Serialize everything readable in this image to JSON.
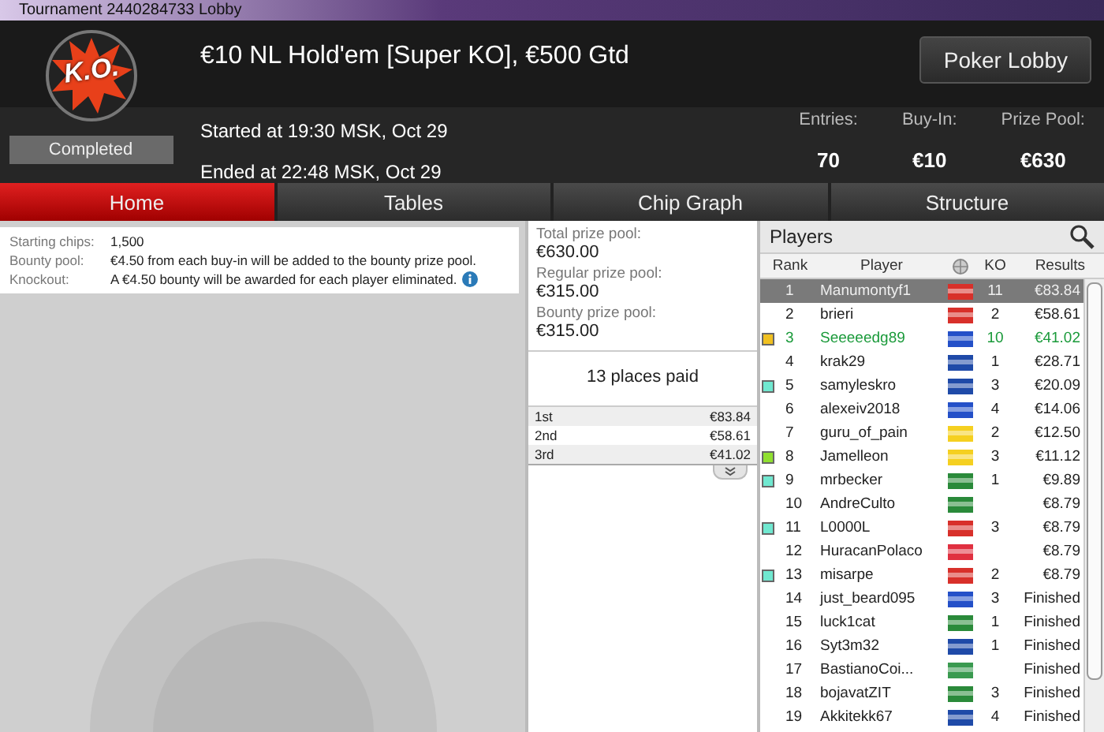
{
  "window": {
    "title": "Tournament 2440284733 Lobby"
  },
  "tournament": {
    "logo_text": "K.O.",
    "name": "€10 NL Hold'em [Super KO], €500 Gtd",
    "status": "Completed",
    "started": "Started at 19:30 MSK, Oct 29",
    "ended": "Ended at 22:48 MSK, Oct 29",
    "lobby_button": "Poker Lobby",
    "stats": [
      {
        "label": "Entries:",
        "value": "70"
      },
      {
        "label": "Buy-In:",
        "value": "€10"
      },
      {
        "label": "Prize Pool:",
        "value": "€630"
      }
    ]
  },
  "tabs": [
    {
      "label": "Home",
      "selected": true
    },
    {
      "label": "Tables",
      "selected": false
    },
    {
      "label": "Chip Graph",
      "selected": false
    },
    {
      "label": "Structure",
      "selected": false
    }
  ],
  "info": [
    {
      "label": "Starting chips:",
      "value": "1,500",
      "info_icon": false
    },
    {
      "label": "Bounty pool:",
      "value": "€4.50 from each buy-in will be added to the bounty prize pool.",
      "info_icon": false
    },
    {
      "label": "Knockout:",
      "value": "A €4.50 bounty will be awarded for each player eliminated.",
      "info_icon": true
    }
  ],
  "prize_pool": [
    {
      "label": "Total prize pool:",
      "value": "€630.00"
    },
    {
      "label": "Regular prize pool:",
      "value": "€315.00"
    },
    {
      "label": "Bounty prize pool:",
      "value": "€315.00"
    }
  ],
  "places_paid": "13 places paid",
  "payouts": [
    {
      "place": "1st",
      "amount": "€83.84"
    },
    {
      "place": "2nd",
      "amount": "€58.61"
    },
    {
      "place": "3rd",
      "amount": "€41.02"
    }
  ],
  "players": {
    "title": "Players",
    "columns": [
      "Rank",
      "Player",
      "KO",
      "Results"
    ],
    "rows": [
      {
        "rank": "1",
        "player": "Manumontyf1",
        "flag": {
          "color": "#d8302a"
        },
        "ko": "11",
        "result": "€83.84",
        "selected": true,
        "highlighted": false,
        "marker": null
      },
      {
        "rank": "2",
        "player": "brieri",
        "flag": {
          "color": "#d8302a"
        },
        "ko": "2",
        "result": "€58.61",
        "selected": false,
        "highlighted": false,
        "marker": null
      },
      {
        "rank": "3",
        "player": "Seeeeedg89",
        "flag": {
          "color": "#2450c8"
        },
        "ko": "10",
        "result": "€41.02",
        "selected": false,
        "highlighted": true,
        "marker": {
          "color": "#f0c020"
        }
      },
      {
        "rank": "4",
        "player": "krak29",
        "flag": {
          "color": "#1f4aa8"
        },
        "ko": "1",
        "result": "€28.71",
        "selected": false,
        "highlighted": false,
        "marker": null
      },
      {
        "rank": "5",
        "player": "samyleskro",
        "flag": {
          "color": "#1f4aa8"
        },
        "ko": "3",
        "result": "€20.09",
        "selected": false,
        "highlighted": false,
        "marker": {
          "color": "#70e8d0"
        }
      },
      {
        "rank": "6",
        "player": "alexeiv2018",
        "flag": {
          "color": "#2450c8"
        },
        "ko": "4",
        "result": "€14.06",
        "selected": false,
        "highlighted": false,
        "marker": null
      },
      {
        "rank": "7",
        "player": "guru_of_pain",
        "flag": {
          "color": "#f5d020"
        },
        "ko": "2",
        "result": "€12.50",
        "selected": false,
        "highlighted": false,
        "marker": null
      },
      {
        "rank": "8",
        "player": "Jamelleon",
        "flag": {
          "color": "#f5d020"
        },
        "ko": "3",
        "result": "€11.12",
        "selected": false,
        "highlighted": false,
        "marker": {
          "color": "#90e030"
        }
      },
      {
        "rank": "9",
        "player": "mrbecker",
        "flag": {
          "color": "#2a8a3a"
        },
        "ko": "1",
        "result": "€9.89",
        "selected": false,
        "highlighted": false,
        "marker": {
          "color": "#70e8d0"
        }
      },
      {
        "rank": "10",
        "player": "AndreCulto",
        "flag": {
          "color": "#2a8a3a"
        },
        "ko": "",
        "result": "€8.79",
        "selected": false,
        "highlighted": false,
        "marker": null
      },
      {
        "rank": "11",
        "player": "L0000L",
        "flag": {
          "color": "#d8302a"
        },
        "ko": "3",
        "result": "€8.79",
        "selected": false,
        "highlighted": false,
        "marker": {
          "color": "#70e8d0"
        }
      },
      {
        "rank": "12",
        "player": "HuracanPolaco",
        "flag": {
          "color": "#e03040"
        },
        "ko": "",
        "result": "€8.79",
        "selected": false,
        "highlighted": false,
        "marker": null
      },
      {
        "rank": "13",
        "player": "misarpe",
        "flag": {
          "color": "#d8302a"
        },
        "ko": "2",
        "result": "€8.79",
        "selected": false,
        "highlighted": false,
        "marker": {
          "color": "#70e8d0"
        }
      },
      {
        "rank": "14",
        "player": "just_beard095",
        "flag": {
          "color": "#2450c8"
        },
        "ko": "3",
        "result": "Finished",
        "selected": false,
        "highlighted": false,
        "marker": null
      },
      {
        "rank": "15",
        "player": "luck1cat",
        "flag": {
          "color": "#2a8a3a"
        },
        "ko": "1",
        "result": "Finished",
        "selected": false,
        "highlighted": false,
        "marker": null
      },
      {
        "rank": "16",
        "player": "Syt3m32",
        "flag": {
          "color": "#1f4aa8"
        },
        "ko": "1",
        "result": "Finished",
        "selected": false,
        "highlighted": false,
        "marker": null
      },
      {
        "rank": "17",
        "player": "BastianoCoi...",
        "flag": {
          "color": "#3a9a50"
        },
        "ko": "",
        "result": "Finished",
        "selected": false,
        "highlighted": false,
        "marker": null
      },
      {
        "rank": "18",
        "player": "bojavatZIT",
        "flag": {
          "color": "#2a8a3a"
        },
        "ko": "3",
        "result": "Finished",
        "selected": false,
        "highlighted": false,
        "marker": null
      },
      {
        "rank": "19",
        "player": "Akkitekk67",
        "flag": {
          "color": "#1f4aa8"
        },
        "ko": "4",
        "result": "Finished",
        "selected": false,
        "highlighted": false,
        "marker": null
      }
    ]
  }
}
